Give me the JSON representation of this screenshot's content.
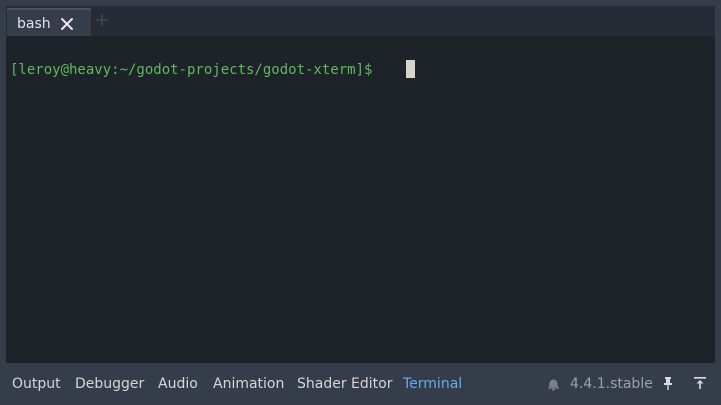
{
  "tabs": [
    {
      "label": "bash",
      "close_icon": "close-icon"
    }
  ],
  "add_tab_icon": "plus-icon",
  "terminal": {
    "prompt": "[leroy@heavy:~/godot-projects/godot-xterm]$ "
  },
  "bottom_panel": {
    "tabs": [
      {
        "label": "Output"
      },
      {
        "label": "Debugger"
      },
      {
        "label": "Audio"
      },
      {
        "label": "Animation"
      },
      {
        "label": "Shader Editor"
      },
      {
        "label": "Terminal",
        "active": true
      }
    ],
    "version": "4.4.1.stable",
    "icons": [
      "bell-icon",
      "pin-icon",
      "expand-panel-icon"
    ]
  },
  "colors": {
    "prompt": "#5fb95f",
    "active_tab": "#6aa9ee",
    "terminal_bg": "#1e2229",
    "editor_bg": "#363d4a"
  }
}
